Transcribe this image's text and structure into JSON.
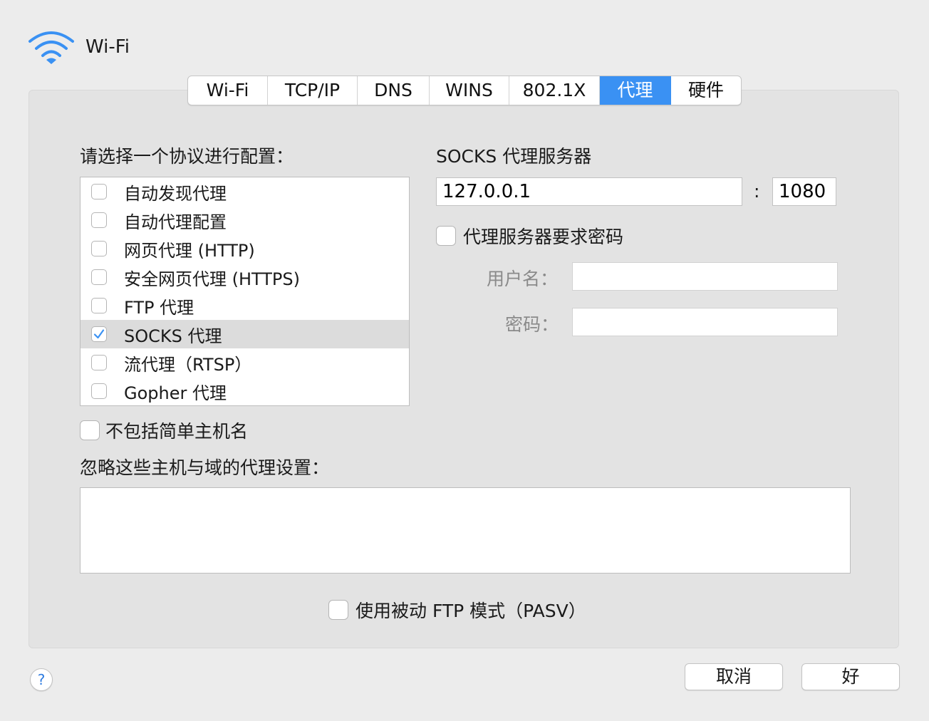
{
  "window": {
    "title": "Wi-Fi"
  },
  "colors": {
    "accent": "#3a91f3"
  },
  "tabs": [
    {
      "label": "Wi-Fi",
      "active": false
    },
    {
      "label": "TCP/IP",
      "active": false
    },
    {
      "label": "DNS",
      "active": false
    },
    {
      "label": "WINS",
      "active": false
    },
    {
      "label": "802.1X",
      "active": false
    },
    {
      "label": "代理",
      "active": true
    },
    {
      "label": "硬件",
      "active": false
    }
  ],
  "protocols": {
    "heading": "请选择一个协议进行配置：",
    "items": [
      {
        "label": "自动发现代理",
        "checked": false,
        "selected": false
      },
      {
        "label": "自动代理配置",
        "checked": false,
        "selected": false
      },
      {
        "label": "网页代理 (HTTP)",
        "checked": false,
        "selected": false
      },
      {
        "label": "安全网页代理 (HTTPS)",
        "checked": false,
        "selected": false
      },
      {
        "label": "FTP 代理",
        "checked": false,
        "selected": false
      },
      {
        "label": "SOCKS 代理",
        "checked": true,
        "selected": true
      },
      {
        "label": "流代理（RTSP）",
        "checked": false,
        "selected": false
      },
      {
        "label": "Gopher 代理",
        "checked": false,
        "selected": false
      }
    ]
  },
  "server": {
    "heading": "SOCKS 代理服务器",
    "host": "127.0.0.1",
    "separator": ":",
    "port": "1080",
    "auth_label": "代理服务器要求密码",
    "auth_checked": false,
    "username_label": "用户名：",
    "username_value": "",
    "password_label": "密码：",
    "password_value": ""
  },
  "exclude_simple": {
    "label": "不包括简单主机名",
    "checked": false
  },
  "bypass": {
    "label": "忽略这些主机与域的代理设置：",
    "value": ""
  },
  "passive_ftp": {
    "label": "使用被动 FTP 模式（PASV）",
    "checked": false
  },
  "buttons": {
    "help": "?",
    "cancel": "取消",
    "ok": "好"
  }
}
